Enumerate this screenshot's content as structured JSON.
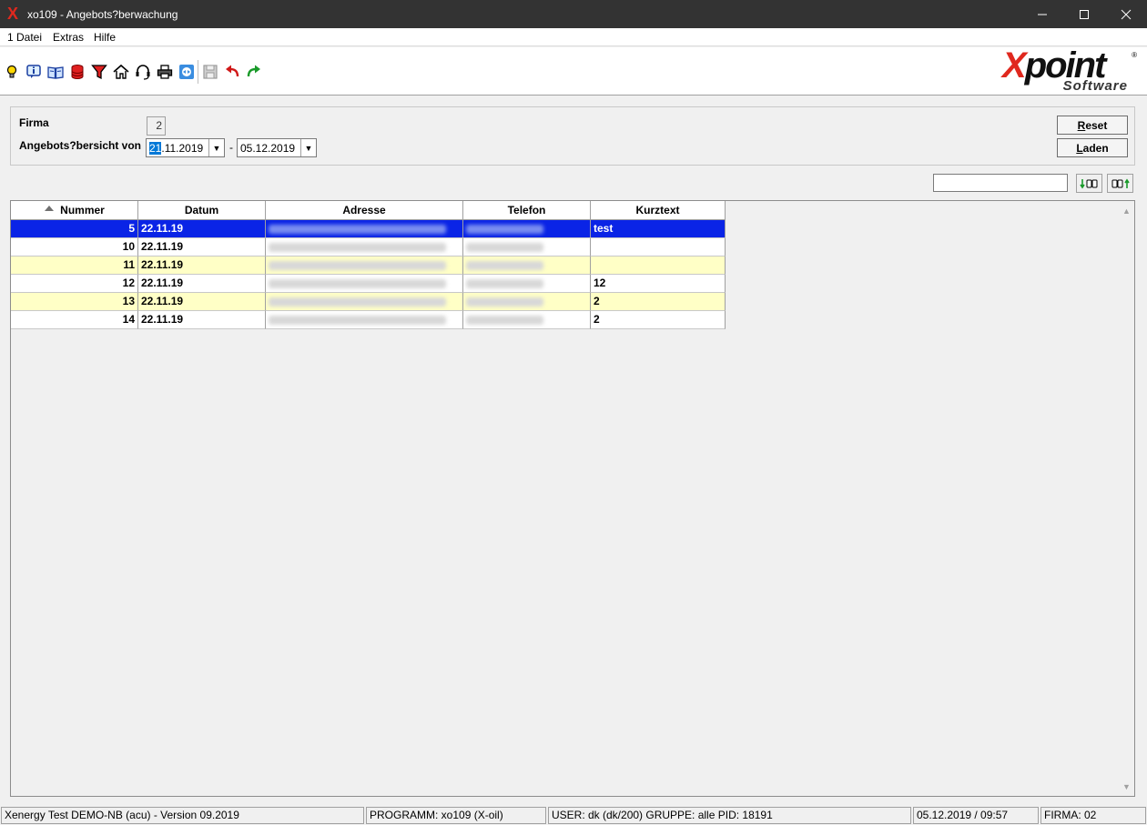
{
  "window": {
    "app_icon": "X",
    "title": "xo109 - Angebots?berwachung"
  },
  "menu": {
    "items": [
      "1 Datei",
      "Extras",
      "Hilfe"
    ]
  },
  "toolbar": {
    "icons": [
      "lightbulb-icon",
      "info-icon",
      "book-icon",
      "database-icon",
      "filter-icon",
      "home-icon",
      "headset-icon",
      "printer-icon",
      "teamviewer-icon",
      "save-icon",
      "undo-icon",
      "redo-icon"
    ]
  },
  "logo": {
    "text_x": "X",
    "text_rest": "point",
    "sub": "Software",
    "reg": "®"
  },
  "filter": {
    "firma_label": "Firma",
    "firma_value": "2",
    "range_label": "Angebots?bersicht von",
    "date_from_selected": "21",
    "date_from_rest": ".11.2019",
    "dash": "-",
    "date_to": "05.12.2019",
    "reset_label_u": "R",
    "reset_label_rest": "eset",
    "laden_label_u": "L",
    "laden_label_rest": "aden"
  },
  "search": {
    "value": ""
  },
  "table": {
    "columns": [
      "Nummer",
      "Datum",
      "Adresse",
      "Telefon",
      "Kurztext"
    ],
    "sorted_column": "Nummer",
    "rows": [
      {
        "nummer": "5",
        "datum": "22.11.19",
        "kurztext": "test",
        "selected": true
      },
      {
        "nummer": "10",
        "datum": "22.11.19",
        "kurztext": "",
        "selected": false
      },
      {
        "nummer": "11",
        "datum": "22.11.19",
        "kurztext": "",
        "selected": false
      },
      {
        "nummer": "12",
        "datum": "22.11.19",
        "kurztext": "12",
        "selected": false
      },
      {
        "nummer": "13",
        "datum": "22.11.19",
        "kurztext": "2",
        "selected": false
      },
      {
        "nummer": "14",
        "datum": "22.11.19",
        "kurztext": "2",
        "selected": false
      }
    ]
  },
  "colors": {
    "selected_row": "#0a24e6",
    "alt_row": "#ffffc6",
    "normal_row": "#ffffff",
    "titlebar": "#333333"
  },
  "status": {
    "system": "Xenergy Test DEMO-NB (acu) - Version 09.2019",
    "program": "PROGRAMM: xo109 (X-oil)",
    "user": "USER: dk (dk/200)  GRUPPE: alle  PID: 18191",
    "datetime": "05.12.2019 / 09:57",
    "firma": "FIRMA: 02"
  }
}
